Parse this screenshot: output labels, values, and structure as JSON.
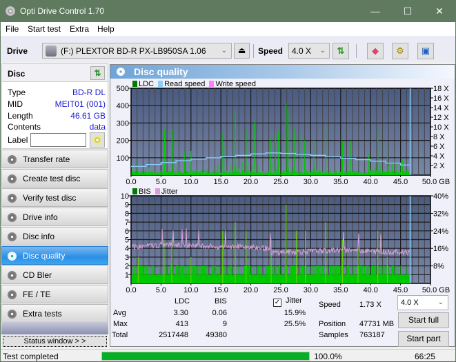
{
  "window": {
    "title": "Opti Drive Control 1.70",
    "controls": {
      "minimize": "—",
      "maximize": "☐",
      "close": "✕"
    }
  },
  "menu": [
    "File",
    "Start test",
    "Extra",
    "Help"
  ],
  "toolbar": {
    "drive_label": "Drive",
    "drive_value": "(F:)  PLEXTOR BD-R  PX-LB950SA 1.06",
    "eject_icon": "eject-icon",
    "speed_label": "Speed",
    "speed_value": "4.0 X",
    "icons": [
      "refresh-icon",
      "eraser-icon",
      "settings-icon",
      "save-icon"
    ]
  },
  "disc": {
    "title": "Disc",
    "rows": [
      {
        "key": "Type",
        "value": "BD-R DL"
      },
      {
        "key": "MID",
        "value": "MEIT01 (001)"
      },
      {
        "key": "Length",
        "value": "46.61 GB"
      },
      {
        "key": "Contents",
        "value": "data"
      }
    ],
    "label_key": "Label",
    "label_value": ""
  },
  "nav": [
    {
      "label": "Transfer rate",
      "active": false
    },
    {
      "label": "Create test disc",
      "active": false
    },
    {
      "label": "Verify test disc",
      "active": false
    },
    {
      "label": "Drive info",
      "active": false
    },
    {
      "label": "Disc info",
      "active": false
    },
    {
      "label": "Disc quality",
      "active": true
    },
    {
      "label": "CD Bler",
      "active": false
    },
    {
      "label": "FE / TE",
      "active": false
    },
    {
      "label": "Extra tests",
      "active": false
    }
  ],
  "status_window_button": "Status window > >",
  "panel_title": "Disc quality",
  "colors": {
    "ldc": "#00c800",
    "read_speed": "#87cefa",
    "write_speed": "#ff80ff",
    "bis": "#00c800",
    "jitter": "#d8a0d8",
    "accent": "#2a8ee6",
    "progress": "#06b025"
  },
  "chart_data": [
    {
      "type": "bar",
      "title": "LDC / Read speed",
      "legend": [
        "LDC",
        "Read speed",
        "Write speed"
      ],
      "legend_position": "top-left",
      "xlabel": "GB",
      "x_ticks": [
        "0.0",
        "5.0",
        "10.0",
        "15.0",
        "20.0",
        "25.0",
        "30.0",
        "35.0",
        "40.0",
        "45.0",
        "50.0 GB"
      ],
      "xlim": [
        0,
        50
      ],
      "y_ticks": [
        "100",
        "200",
        "300",
        "400",
        "500"
      ],
      "ylim": [
        0,
        500
      ],
      "y2_ticks": [
        "2 X",
        "4 X",
        "6 X",
        "8 X",
        "10 X",
        "12 X",
        "14 X",
        "16 X",
        "18 X"
      ],
      "y2lim": [
        0,
        18
      ],
      "grid": true,
      "end_marker_gb": 46.61,
      "ldc_spikes": [
        {
          "x": 5.6,
          "y": 260
        },
        {
          "x": 6.9,
          "y": 265
        },
        {
          "x": 8.9,
          "y": 130
        },
        {
          "x": 10.0,
          "y": 140
        },
        {
          "x": 15.2,
          "y": 245
        },
        {
          "x": 15.5,
          "y": 170
        },
        {
          "x": 17.4,
          "y": 370
        },
        {
          "x": 19.2,
          "y": 265
        },
        {
          "x": 20.6,
          "y": 305
        },
        {
          "x": 23.3,
          "y": 210
        },
        {
          "x": 24.1,
          "y": 250
        },
        {
          "x": 24.6,
          "y": 255
        },
        {
          "x": 25.9,
          "y": 413
        },
        {
          "x": 26.2,
          "y": 375
        },
        {
          "x": 27.3,
          "y": 265
        },
        {
          "x": 28.4,
          "y": 245
        },
        {
          "x": 29.0,
          "y": 200
        },
        {
          "x": 30.5,
          "y": 200
        },
        {
          "x": 32.5,
          "y": 300
        },
        {
          "x": 35.3,
          "y": 195
        },
        {
          "x": 36.6,
          "y": 195
        },
        {
          "x": 39.7,
          "y": 120
        },
        {
          "x": 41.2,
          "y": 260
        },
        {
          "x": 42.8,
          "y": 195
        },
        {
          "x": 45.3,
          "y": 90
        }
      ],
      "ldc_baseline": 15,
      "read_speed_series": [
        {
          "x": 0,
          "y": 1.8
        },
        {
          "x": 2.5,
          "y": 2.2
        },
        {
          "x": 5,
          "y": 2.6
        },
        {
          "x": 7.5,
          "y": 3.0
        },
        {
          "x": 10,
          "y": 3.3
        },
        {
          "x": 12.5,
          "y": 3.6
        },
        {
          "x": 15,
          "y": 3.9
        },
        {
          "x": 17.5,
          "y": 4.1
        },
        {
          "x": 20,
          "y": 4.4
        },
        {
          "x": 22.5,
          "y": 4.6
        },
        {
          "x": 25,
          "y": 4.5
        },
        {
          "x": 27.5,
          "y": 4.3
        },
        {
          "x": 30,
          "y": 4.1
        },
        {
          "x": 32.5,
          "y": 3.8
        },
        {
          "x": 35,
          "y": 3.5
        },
        {
          "x": 37.5,
          "y": 3.2
        },
        {
          "x": 40,
          "y": 2.9
        },
        {
          "x": 42.5,
          "y": 2.5
        },
        {
          "x": 45,
          "y": 2.1
        },
        {
          "x": 46.6,
          "y": 1.9
        }
      ]
    },
    {
      "type": "bar",
      "title": "BIS / Jitter",
      "legend": [
        "BIS",
        "Jitter"
      ],
      "legend_position": "top-left",
      "xlabel": "GB",
      "x_ticks": [
        "0.0",
        "5.0",
        "10.0",
        "15.0",
        "20.0",
        "25.0",
        "30.0",
        "35.0",
        "40.0",
        "45.0",
        "50.0 GB"
      ],
      "xlim": [
        0,
        50
      ],
      "y_ticks": [
        "1",
        "2",
        "3",
        "4",
        "5",
        "6",
        "7",
        "8",
        "9",
        "10"
      ],
      "ylim": [
        0,
        10
      ],
      "y2_ticks": [
        "8%",
        "16%",
        "24%",
        "32%",
        "40%"
      ],
      "y2lim": [
        0,
        40
      ],
      "grid": true,
      "end_marker_gb": 46.61,
      "bis_spikes": [
        {
          "x": 1.2,
          "y": 3
        },
        {
          "x": 5.5,
          "y": 5
        },
        {
          "x": 6.8,
          "y": 5
        },
        {
          "x": 10.0,
          "y": 3
        },
        {
          "x": 15.3,
          "y": 6
        },
        {
          "x": 17.4,
          "y": 7
        },
        {
          "x": 19.2,
          "y": 6
        },
        {
          "x": 23.4,
          "y": 5
        },
        {
          "x": 25.9,
          "y": 9
        },
        {
          "x": 27.6,
          "y": 6
        },
        {
          "x": 29.1,
          "y": 6
        },
        {
          "x": 32.5,
          "y": 7
        },
        {
          "x": 35.3,
          "y": 5
        },
        {
          "x": 37.9,
          "y": 5
        },
        {
          "x": 41.2,
          "y": 6
        },
        {
          "x": 42.8,
          "y": 3
        }
      ],
      "bis_baseline": 1,
      "jitter_series": [
        {
          "x": 0,
          "y": 16.5
        },
        {
          "x": 2.5,
          "y": 17.0
        },
        {
          "x": 5,
          "y": 17.6
        },
        {
          "x": 7.5,
          "y": 17.6
        },
        {
          "x": 10,
          "y": 17.4
        },
        {
          "x": 12.5,
          "y": 17.2
        },
        {
          "x": 15,
          "y": 16.8
        },
        {
          "x": 17.5,
          "y": 17.0
        },
        {
          "x": 20,
          "y": 16.8
        },
        {
          "x": 22.5,
          "y": 16.0
        },
        {
          "x": 23.5,
          "y": 14.0
        },
        {
          "x": 25,
          "y": 14.2
        },
        {
          "x": 27.5,
          "y": 14.4
        },
        {
          "x": 30,
          "y": 14.6
        },
        {
          "x": 32.5,
          "y": 15.0
        },
        {
          "x": 35,
          "y": 15.2
        },
        {
          "x": 37.5,
          "y": 15.2
        },
        {
          "x": 40,
          "y": 14.6
        },
        {
          "x": 42.5,
          "y": 14.4
        },
        {
          "x": 45,
          "y": 14.4
        },
        {
          "x": 46.6,
          "y": 14.4
        }
      ]
    }
  ],
  "stats": {
    "headers": [
      "LDC",
      "BIS"
    ],
    "jitter_label": "Jitter",
    "jitter_checked": true,
    "rows": [
      {
        "label": "Avg",
        "ldc": "3.30",
        "bis": "0.06",
        "jitter": "15.9%"
      },
      {
        "label": "Max",
        "ldc": "413",
        "bis": "9",
        "jitter": "25.5%"
      },
      {
        "label": "Total",
        "ldc": "2517448",
        "bis": "49380",
        "jitter": ""
      }
    ],
    "speed_label": "Speed",
    "speed_value": "1.73 X",
    "position_label": "Position",
    "position_value": "47731 MB",
    "samples_label": "Samples",
    "samples_value": "763187",
    "speed_select": "4.0 X",
    "start_full": "Start full",
    "start_part": "Start part"
  },
  "statusbar": {
    "text": "Test completed",
    "progress": 1.0,
    "percent": "100.0%",
    "time": "66:25"
  }
}
